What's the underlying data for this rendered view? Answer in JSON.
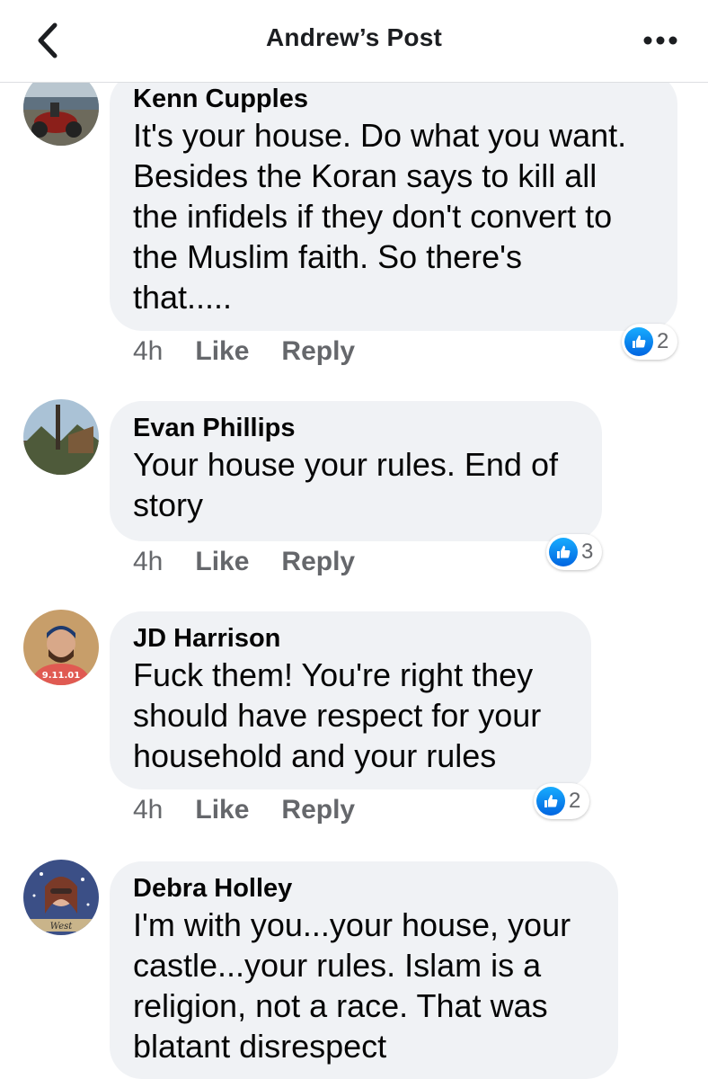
{
  "header": {
    "title": "Andrew’s Post",
    "back_icon": "chevron-left-icon",
    "more_icon": "more-dots-icon"
  },
  "colors": {
    "bubble": "#f0f2f5",
    "meta": "#65676b",
    "like_blue": "#1877f2"
  },
  "comments": [
    {
      "author": "Kenn Cupples",
      "text": "It's your house. Do what you want.\nBesides the Koran says to kill all\nthe infidels if they don't convert to\nthe Muslim faith.  So there's\nthat.....",
      "time": "4h",
      "like_label": "Like",
      "reply_label": "Reply",
      "reactions": "2"
    },
    {
      "author": "Evan Phillips",
      "text": "Your house your rules. End of\nstory",
      "time": "4h",
      "like_label": "Like",
      "reply_label": "Reply",
      "reactions": "3"
    },
    {
      "author": "JD Harrison",
      "text": "Fuck them! You're right they\nshould have respect for your\nhousehold and your rules",
      "time": "4h",
      "like_label": "Like",
      "reply_label": "Reply",
      "reactions": "2"
    },
    {
      "author": "Debra Holley",
      "text": "I'm with you...your house, your\ncastle...your rules. Islam is a\nreligion, not a race. That was\nblatant disrespect",
      "time": "",
      "like_label": "",
      "reply_label": "",
      "reactions": ""
    }
  ]
}
